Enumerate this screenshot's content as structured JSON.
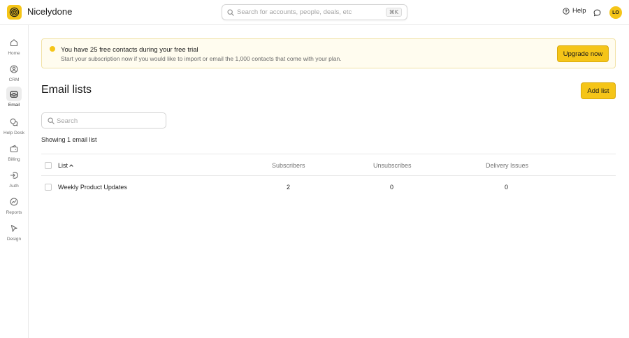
{
  "app": {
    "name": "Nicelydone",
    "brand_color": "#f5c518",
    "logo_icon": "target-spiral-icon"
  },
  "topbar": {
    "search_placeholder": "Search for accounts, people, deals, etc",
    "search_shortcut": "⌘K",
    "help_label": "Help",
    "user_initials": "LO"
  },
  "sidebar": {
    "items": [
      {
        "label": "Home",
        "icon": "home-icon",
        "active": false
      },
      {
        "label": "CRM",
        "icon": "user-circle-icon",
        "active": false
      },
      {
        "label": "Email",
        "icon": "mail-icon",
        "active": true
      },
      {
        "label": "Help Desk",
        "icon": "chat-bubbles-icon",
        "active": false
      },
      {
        "label": "Billing",
        "icon": "wallet-icon",
        "active": false
      },
      {
        "label": "Auth",
        "icon": "login-icon",
        "active": false
      },
      {
        "label": "Reports",
        "icon": "chart-circle-icon",
        "active": false
      },
      {
        "label": "Design",
        "icon": "cursor-icon",
        "active": false
      }
    ]
  },
  "banner": {
    "title": "You have 25 free contacts during your free trial",
    "subtitle": "Start your subscription now if you would like to import or email the 1,000 contacts that come with your plan.",
    "button_label": "Upgrade now"
  },
  "page": {
    "title": "Email lists",
    "add_button_label": "Add list",
    "search_placeholder": "Search",
    "showing_text": "Showing 1 email list"
  },
  "table": {
    "columns": {
      "list": "List",
      "subscribers": "Subscribers",
      "unsubscribes": "Unsubscribes",
      "delivery_issues": "Delivery Issues"
    },
    "rows": [
      {
        "name": "Weekly Product Updates",
        "subscribers": "2",
        "unsubscribes": "0",
        "delivery_issues": "0"
      }
    ]
  }
}
